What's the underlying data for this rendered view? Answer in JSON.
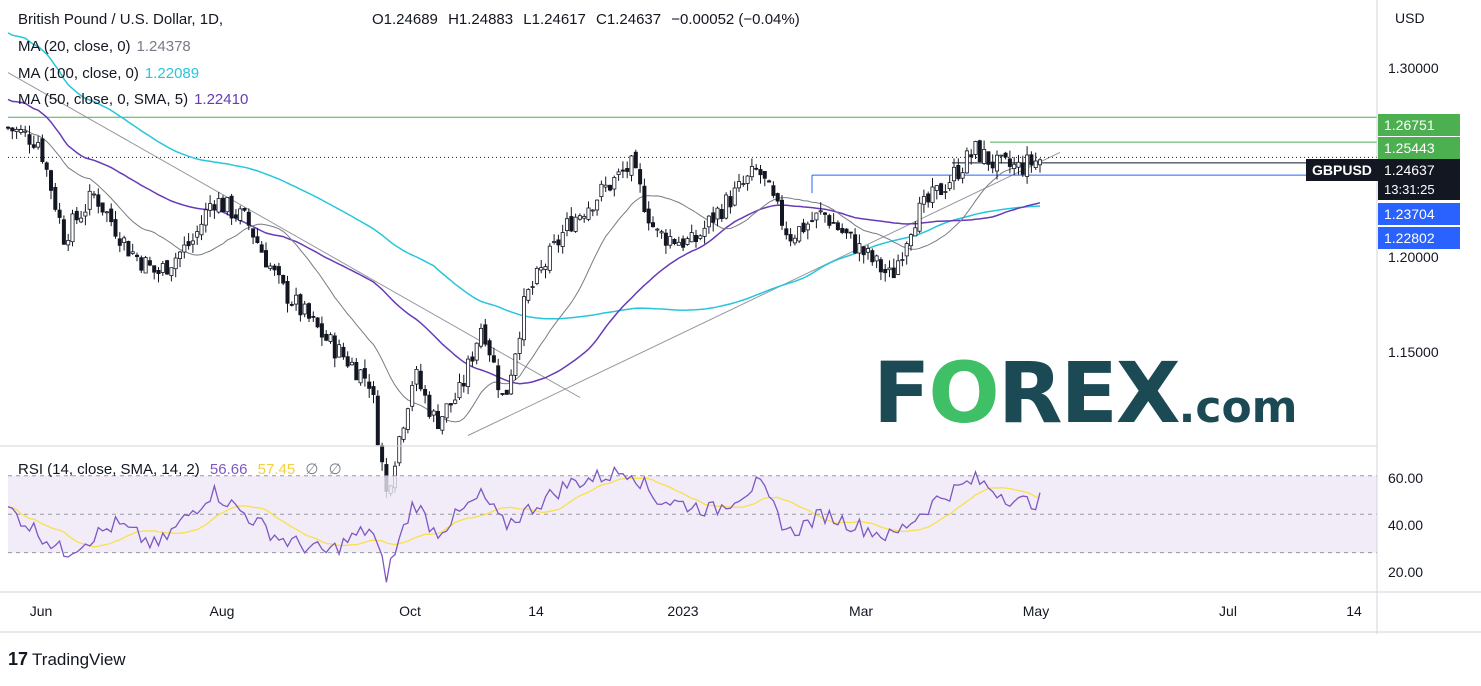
{
  "header": {
    "title": "British Pound / U.S. Dollar, 1D,",
    "ohlc": {
      "open": "O1.24689",
      "high": "H1.24883",
      "low": "L1.24617",
      "close": "C1.24637",
      "change": "−0.00052 (−0.04%)"
    }
  },
  "indicators": {
    "ma20": {
      "label": "MA (20, close, 0)",
      "value": "1.24378",
      "color": "#787b86"
    },
    "ma100": {
      "label": "MA (100, close, 0)",
      "value": "1.22089",
      "color": "#26c6da"
    },
    "ma50": {
      "label": "MA (50, close, 0, SMA, 5)",
      "value": "1.22410",
      "color": "#673ab7"
    },
    "rsi": {
      "label": "RSI (14, close, SMA, 14, 2)",
      "value": "56.66",
      "sma_value": "57.45",
      "extra1": "∅",
      "extra2": "∅",
      "line_color": "#7e57c2",
      "sma_color": "#f9e04b"
    }
  },
  "price_axis": {
    "currency": "USD",
    "ticks": [
      "1.30000",
      "1.20000",
      "1.15000"
    ],
    "tags": [
      {
        "value": "1.26751",
        "color": "#4caf50"
      },
      {
        "value": "1.25443",
        "color": "#4caf50"
      },
      {
        "value": "1.24637",
        "color": "#131722"
      },
      {
        "value": "1.23704",
        "color": "#2962ff"
      },
      {
        "value": "1.22802",
        "color": "#2962ff"
      }
    ],
    "symbol": "GBPUSD",
    "countdown": "13:31:25"
  },
  "rsi_axis": {
    "ticks": [
      "60.00",
      "40.00",
      "20.00"
    ]
  },
  "time_axis": {
    "labels": [
      "Jun",
      "Aug",
      "Oct",
      "14",
      "2023",
      "Mar",
      "May",
      "Jul",
      "14"
    ]
  },
  "watermark": {
    "brand_part1": "F",
    "brand_o": "O",
    "brand_part2": "REX",
    "brand_suffix": ".com"
  },
  "footer": {
    "logo_mark": "17",
    "logo_text": "TradingView"
  },
  "chart_data": {
    "type": "candlestick",
    "instrument": "GBPUSD",
    "timeframe": "1D",
    "currency": "USD",
    "price_range": [
      1.095,
      1.325
    ],
    "rsi_range": [
      10,
      85
    ],
    "close_path": [
      {
        "x": "2022-05-27",
        "y": 1.262
      },
      {
        "x": "2022-06-06",
        "y": 1.255
      },
      {
        "x": "2022-06-14",
        "y": 1.205
      },
      {
        "x": "2022-06-24",
        "y": 1.227
      },
      {
        "x": "2022-07-05",
        "y": 1.198
      },
      {
        "x": "2022-07-14",
        "y": 1.185
      },
      {
        "x": "2022-07-26",
        "y": 1.203
      },
      {
        "x": "2022-08-01",
        "y": 1.225
      },
      {
        "x": "2022-08-12",
        "y": 1.213
      },
      {
        "x": "2022-08-23",
        "y": 1.178
      },
      {
        "x": "2022-09-07",
        "y": 1.15
      },
      {
        "x": "2022-09-21",
        "y": 1.128
      },
      {
        "x": "2022-09-26",
        "y": 1.069
      },
      {
        "x": "2022-10-05",
        "y": 1.133
      },
      {
        "x": "2022-10-12",
        "y": 1.107
      },
      {
        "x": "2022-10-20",
        "y": 1.123
      },
      {
        "x": "2022-10-27",
        "y": 1.16
      },
      {
        "x": "2022-11-03",
        "y": 1.117
      },
      {
        "x": "2022-11-10",
        "y": 1.172
      },
      {
        "x": "2022-11-24",
        "y": 1.212
      },
      {
        "x": "2022-12-05",
        "y": 1.229
      },
      {
        "x": "2022-12-14",
        "y": 1.242
      },
      {
        "x": "2022-12-22",
        "y": 1.206
      },
      {
        "x": "2023-01-03",
        "y": 1.201
      },
      {
        "x": "2023-01-10",
        "y": 1.216
      },
      {
        "x": "2023-01-24",
        "y": 1.24
      },
      {
        "x": "2023-02-03",
        "y": 1.205
      },
      {
        "x": "2023-02-14",
        "y": 1.217
      },
      {
        "x": "2023-02-27",
        "y": 1.196
      },
      {
        "x": "2023-03-08",
        "y": 1.183
      },
      {
        "x": "2023-03-15",
        "y": 1.214
      },
      {
        "x": "2023-03-23",
        "y": 1.228
      },
      {
        "x": "2023-04-04",
        "y": 1.25
      },
      {
        "x": "2023-04-11",
        "y": 1.242
      },
      {
        "x": "2023-04-18",
        "y": 1.241
      },
      {
        "x": "2023-04-26",
        "y": 1.246
      }
    ],
    "rsi_path": [
      {
        "x": "2022-05-27",
        "y": 53
      },
      {
        "x": "2022-06-14",
        "y": 30
      },
      {
        "x": "2022-07-01",
        "y": 45
      },
      {
        "x": "2022-07-14",
        "y": 33
      },
      {
        "x": "2022-08-01",
        "y": 62
      },
      {
        "x": "2022-08-23",
        "y": 37
      },
      {
        "x": "2022-09-07",
        "y": 30
      },
      {
        "x": "2022-09-21",
        "y": 43
      },
      {
        "x": "2022-09-26",
        "y": 18
      },
      {
        "x": "2022-10-05",
        "y": 57
      },
      {
        "x": "2022-10-12",
        "y": 40
      },
      {
        "x": "2022-10-27",
        "y": 60
      },
      {
        "x": "2022-11-03",
        "y": 44
      },
      {
        "x": "2022-11-24",
        "y": 66
      },
      {
        "x": "2022-12-14",
        "y": 73
      },
      {
        "x": "2022-12-22",
        "y": 58
      },
      {
        "x": "2023-01-10",
        "y": 52
      },
      {
        "x": "2023-01-24",
        "y": 66
      },
      {
        "x": "2023-02-03",
        "y": 40
      },
      {
        "x": "2023-02-14",
        "y": 50
      },
      {
        "x": "2023-03-08",
        "y": 38
      },
      {
        "x": "2023-03-23",
        "y": 58
      },
      {
        "x": "2023-04-04",
        "y": 68
      },
      {
        "x": "2023-04-18",
        "y": 56
      },
      {
        "x": "2023-04-26",
        "y": 57
      }
    ],
    "rsi_levels": [
      70,
      50,
      30
    ],
    "horizontal_levels": [
      1.26751,
      1.25443,
      1.23704
    ],
    "grid": false
  }
}
